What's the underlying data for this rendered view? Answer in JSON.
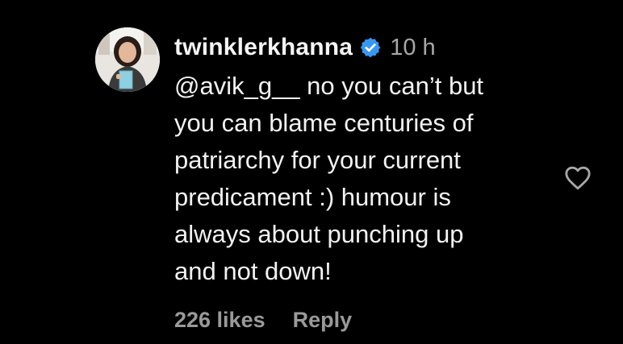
{
  "comment": {
    "username": "twinklerkhanna",
    "verified": true,
    "timestamp": "10 h",
    "text_lines": [
      "@avik_g__ no you can’t but",
      "you can blame centuries of",
      "patriarchy for your current",
      "predicament :) humour is",
      "always about punching up",
      "and not down!"
    ],
    "likes_label": "226 likes",
    "reply_label": "Reply"
  },
  "icons": {
    "verified": "verified-badge-icon",
    "like": "heart-outline-icon",
    "avatar": "profile-avatar"
  },
  "colors": {
    "background": "#000000",
    "verified_blue": "#3897f0",
    "secondary_text": "#a8a8a8"
  }
}
